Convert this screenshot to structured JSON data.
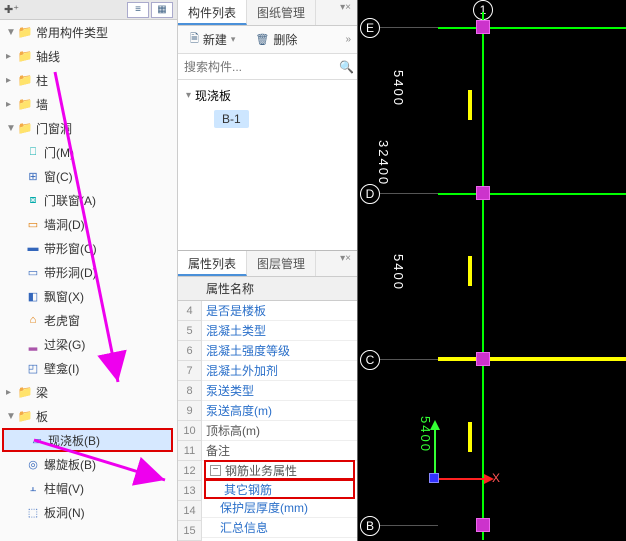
{
  "sidebar": {
    "header_icons": [
      "list",
      "grid"
    ],
    "items": [
      {
        "label": "常用构件类型",
        "level": 1,
        "arrow": "▼",
        "icon": "folder"
      },
      {
        "label": "轴线",
        "level": 1,
        "arrow": "▸",
        "icon": "folder"
      },
      {
        "label": "柱",
        "level": 1,
        "arrow": "▸",
        "icon": "folder"
      },
      {
        "label": "墙",
        "level": 1,
        "arrow": "▸",
        "icon": "folder"
      },
      {
        "label": "门窗洞",
        "level": 1,
        "arrow": "▼",
        "icon": "folder"
      },
      {
        "label": "门(M)",
        "level": 2,
        "icon": "door",
        "cls": "c-teal"
      },
      {
        "label": "窗(C)",
        "level": 2,
        "icon": "window",
        "cls": "c-blue"
      },
      {
        "label": "门联窗(A)",
        "level": 2,
        "icon": "doorwin",
        "cls": "c-teal"
      },
      {
        "label": "墙洞(D)",
        "level": 2,
        "icon": "hole",
        "cls": "c-orange"
      },
      {
        "label": "带形窗(C)",
        "level": 2,
        "icon": "stripwin",
        "cls": "c-blue"
      },
      {
        "label": "带形洞(D)",
        "level": 2,
        "icon": "striphole",
        "cls": "c-blue"
      },
      {
        "label": "飘窗(X)",
        "level": 2,
        "icon": "baywin",
        "cls": "c-blue"
      },
      {
        "label": "老虎窗",
        "level": 2,
        "icon": "dormer",
        "cls": "c-orange"
      },
      {
        "label": "过梁(G)",
        "level": 2,
        "icon": "lintel",
        "cls": "c-purple"
      },
      {
        "label": "壁龛(I)",
        "level": 2,
        "icon": "niche",
        "cls": "c-blue"
      },
      {
        "label": "梁",
        "level": 1,
        "arrow": "▸",
        "icon": "folder"
      },
      {
        "label": "板",
        "level": 1,
        "arrow": "▼",
        "icon": "folder"
      },
      {
        "label": "现浇板(B)",
        "level": 2,
        "icon": "slab",
        "cls": "c-blue",
        "boxed": true
      },
      {
        "label": "螺旋板(B)",
        "level": 2,
        "icon": "spiral",
        "cls": "c-blue"
      },
      {
        "label": "柱帽(V)",
        "level": 2,
        "icon": "cap",
        "cls": "c-blue"
      },
      {
        "label": "板洞(N)",
        "level": 2,
        "icon": "slabhole",
        "cls": "c-blue"
      }
    ]
  },
  "componentList": {
    "tabs": [
      "构件列表",
      "图纸管理"
    ],
    "new_label": "新建",
    "delete_label": "删除",
    "search_placeholder": "搜索构件...",
    "root": "现浇板",
    "child": "B-1"
  },
  "propertyList": {
    "tabs": [
      "属性列表",
      "图层管理"
    ],
    "header": "属性名称",
    "rows": [
      {
        "idx": "4",
        "label": "是否是楼板"
      },
      {
        "idx": "5",
        "label": "混凝土类型"
      },
      {
        "idx": "6",
        "label": "混凝土强度等级"
      },
      {
        "idx": "7",
        "label": "混凝土外加剂"
      },
      {
        "idx": "8",
        "label": "泵送类型"
      },
      {
        "idx": "9",
        "label": "泵送高度(m)"
      },
      {
        "idx": "10",
        "label": "顶标高(m)",
        "plain": true
      },
      {
        "idx": "11",
        "label": "备注",
        "plain": true
      },
      {
        "idx": "12",
        "label": "钢筋业务属性",
        "exp": "−",
        "highlight": true,
        "plain": true
      },
      {
        "idx": "13",
        "label": "其它钢筋",
        "indent": true,
        "highlight": true
      },
      {
        "idx": "14",
        "label": "保护层厚度(mm)",
        "indent": true
      },
      {
        "idx": "15",
        "label": "汇总信息",
        "indent": true
      }
    ]
  },
  "viewport": {
    "axis_labels": {
      "e": "E",
      "d": "D",
      "c": "C",
      "b": "B",
      "one": "1"
    },
    "dims": [
      "5400",
      "32400",
      "5400",
      "5400"
    ],
    "axis_x": "X"
  }
}
